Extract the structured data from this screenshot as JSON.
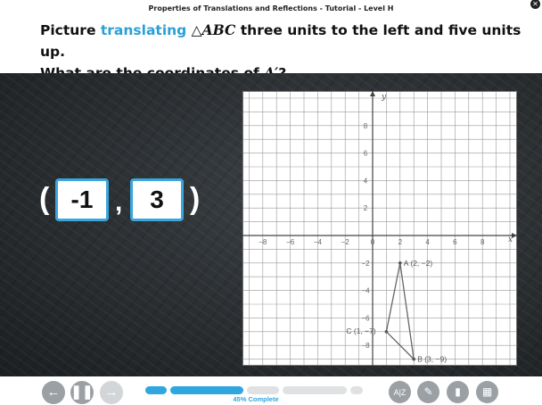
{
  "window": {
    "title": "Properties of Translations and Reflections - Tutorial - Level H"
  },
  "question": {
    "part1": "Picture ",
    "keyword": "translating",
    "triangle_symbol": "△",
    "triangle_name": "ABC",
    "part2": " three units to the left and five units up.",
    "line2_part1": "What are the coordinates of ",
    "point_name": "A′",
    "line2_part2": "?"
  },
  "answer": {
    "open_paren": "(",
    "x_value": "-1",
    "comma": ",",
    "y_value": "3",
    "close_paren": ")"
  },
  "graph": {
    "axis_x_label": "x",
    "axis_y_label": "y",
    "x_ticks": [
      "−8",
      "−6",
      "−4",
      "−2",
      "0",
      "2",
      "4",
      "6",
      "8"
    ],
    "y_ticks": [
      "8",
      "6",
      "4",
      "2",
      "−2",
      "−4",
      "−6",
      "−8"
    ],
    "points": [
      {
        "name": "A",
        "x": 2,
        "y": -2,
        "label": "A (2, −2)"
      },
      {
        "name": "B",
        "x": 3,
        "y": -9,
        "label": "B (3, −9)"
      },
      {
        "name": "C",
        "x": 1,
        "y": -7,
        "label": "C (1, −7)"
      }
    ],
    "triangle_color": "#666666",
    "grid_color": "#999999"
  },
  "controls": {
    "back_icon": "arrow-left-icon",
    "pause_icon": "pause-icon",
    "forward_icon": "arrow-right-icon"
  },
  "progress": {
    "fraction": 0.45,
    "label": "45% Complete"
  },
  "tools": [
    {
      "name": "glossary-button",
      "icon": "glossary-icon",
      "glyph": "A|Z"
    },
    {
      "name": "pencil-button",
      "icon": "pencil-icon",
      "glyph": "✎"
    },
    {
      "name": "notes-button",
      "icon": "notebook-icon",
      "glyph": "▮"
    },
    {
      "name": "calculator-button",
      "icon": "calculator-icon",
      "glyph": "▦"
    }
  ],
  "colors": {
    "accent": "#30a6e0",
    "keyword": "#2ba0d8",
    "board": "#2f3336"
  }
}
